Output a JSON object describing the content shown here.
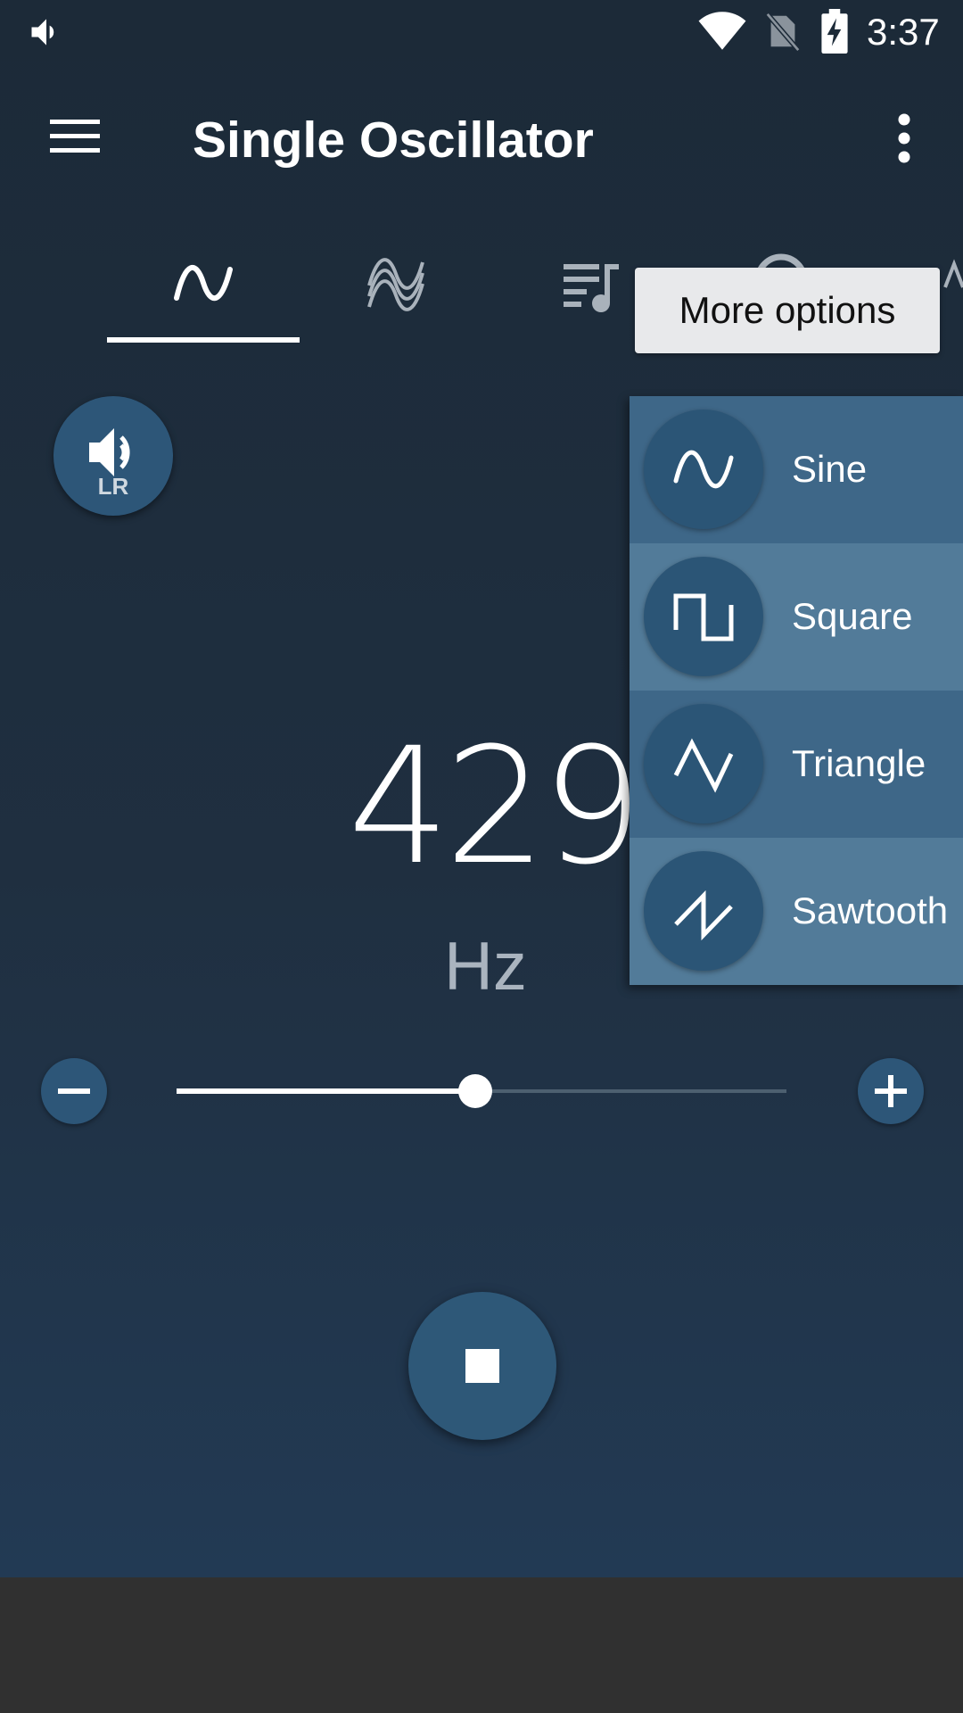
{
  "status_bar": {
    "time": "3:37",
    "icons": [
      "volume-icon",
      "wifi-icon",
      "no-sim-icon",
      "battery-charging-icon"
    ]
  },
  "toolbar": {
    "title": "Single Oscillator",
    "menu_icon": "menu-icon",
    "overflow_icon": "more-vert-icon"
  },
  "tabs": [
    {
      "icon": "sine-wave-icon",
      "selected": true
    },
    {
      "icon": "multi-wave-icon",
      "selected": false
    },
    {
      "icon": "playlist-music-icon",
      "selected": false
    },
    {
      "icon": "headphones-icon",
      "selected": false
    },
    {
      "icon": "sweep-icon",
      "selected": false
    }
  ],
  "tooltip": {
    "text": "More options"
  },
  "channel_button": {
    "label": "LR",
    "icon": "volume-icon"
  },
  "frequency": {
    "value": "429",
    "unit": "Hz"
  },
  "slider": {
    "level": 0.49
  },
  "controls": {
    "minus_icon": "minus-icon",
    "plus_icon": "plus-icon",
    "stop_icon": "stop-icon"
  },
  "waveform_menu": {
    "items": [
      {
        "label": "Sine",
        "icon": "sine-wave-icon"
      },
      {
        "label": "Square",
        "icon": "square-wave-icon"
      },
      {
        "label": "Triangle",
        "icon": "triangle-wave-icon"
      },
      {
        "label": "Sawtooth",
        "icon": "sawtooth-wave-icon"
      }
    ]
  },
  "colors": {
    "background": "#1c2a38",
    "accent": "#2d5678",
    "menu_dark": "#3e6788",
    "menu_light": "#527b99",
    "navbar": "#303030"
  }
}
